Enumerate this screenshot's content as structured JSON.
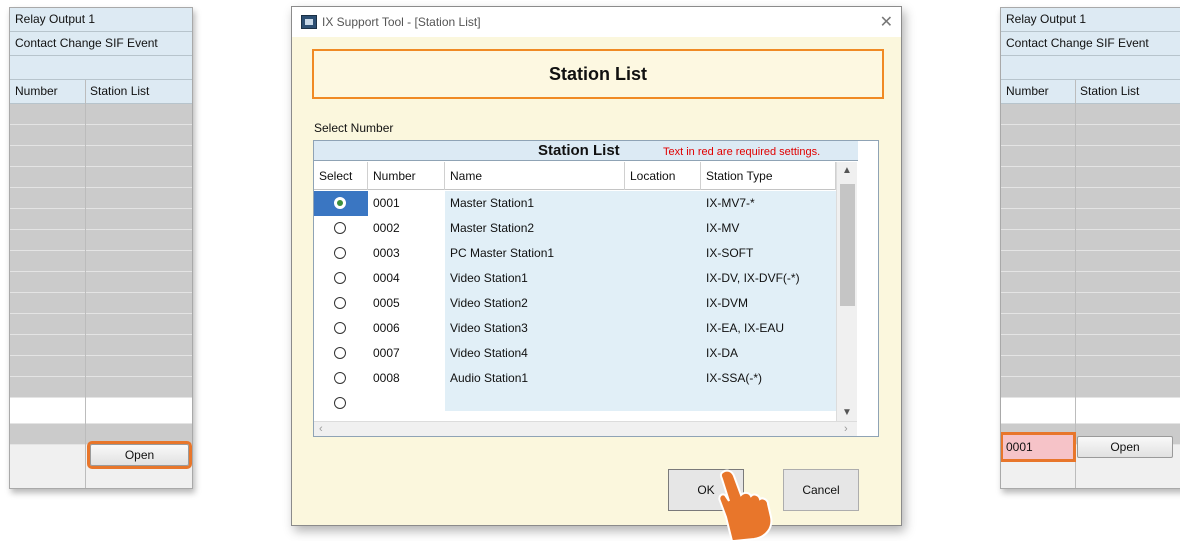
{
  "left_panel": {
    "header_1": "Relay Output 1",
    "header_2": "Contact Change SIF Event",
    "col_number": "Number",
    "col_station_list": "Station List",
    "open_button": "Open"
  },
  "dialog": {
    "title": "IX Support Tool - [Station List]",
    "banner": "Station List",
    "select_number_label": "Select Number",
    "table_title": "Station List",
    "required_note": "Text in red are required settings.",
    "columns": [
      "Select",
      "Number",
      "Name",
      "Location",
      "Station Type"
    ],
    "rows": [
      {
        "number": "0001",
        "name": "Master Station1",
        "location": "",
        "type": "IX-MV7-*",
        "selected": true
      },
      {
        "number": "0002",
        "name": "Master Station2",
        "location": "",
        "type": "IX-MV",
        "selected": false
      },
      {
        "number": "0003",
        "name": "PC Master Station1",
        "location": "",
        "type": "IX-SOFT",
        "selected": false
      },
      {
        "number": "0004",
        "name": "Video Station1",
        "location": "",
        "type": "IX-DV, IX-DVF(-*)",
        "selected": false
      },
      {
        "number": "0005",
        "name": "Video Station2",
        "location": "",
        "type": "IX-DVM",
        "selected": false
      },
      {
        "number": "0006",
        "name": "Video Station3",
        "location": "",
        "type": "IX-EA, IX-EAU",
        "selected": false
      },
      {
        "number": "0007",
        "name": "Video Station4",
        "location": "",
        "type": "IX-DA",
        "selected": false
      },
      {
        "number": "0008",
        "name": "Audio Station1",
        "location": "",
        "type": "IX-SSA(-*)",
        "selected": false
      }
    ],
    "ok_button": "OK",
    "cancel_button": "Cancel"
  },
  "right_panel": {
    "header_1": "Relay Output 1",
    "header_2": "Contact Change SIF Event",
    "col_number": "Number",
    "col_station_list": "Station List",
    "number_value": "0001",
    "open_button": "Open"
  },
  "colors": {
    "highlight": "#e8762b",
    "required_text": "#e00000",
    "selected_row": "#3a76c2",
    "cell_fill": "#e1eff7",
    "dialog_bg": "#fbf7dd"
  }
}
